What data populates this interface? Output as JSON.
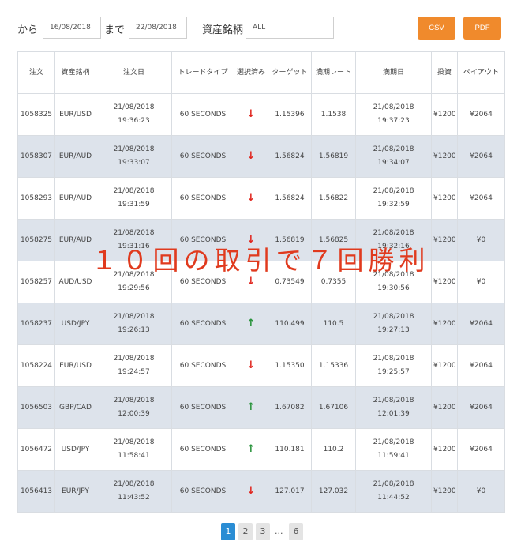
{
  "filters": {
    "from_label": "から",
    "from_value": "16/08/2018",
    "to_label": "まで",
    "to_value": "22/08/2018",
    "asset_label": "資産銘柄",
    "asset_value": "ALL",
    "csv_label": "CSV",
    "pdf_label": "PDF"
  },
  "table": {
    "headers": [
      "注文",
      "資産銘柄",
      "注文日",
      "トレードタイプ",
      "選択済み",
      "ターゲット",
      "満期レート",
      "満期日",
      "投資",
      "ペイアウト"
    ],
    "rows": [
      {
        "id": "1058325",
        "asset": "EUR/USD",
        "order_date": "21/08/2018",
        "order_time": "19:36:23",
        "type": "60 SECONDS",
        "direction": "down",
        "target": "1.15396",
        "expiry_rate": "1.1538",
        "expiry_date": "21/08/2018",
        "expiry_time": "19:37:23",
        "investment": "¥1200",
        "payout": "¥2064"
      },
      {
        "id": "1058307",
        "asset": "EUR/AUD",
        "order_date": "21/08/2018",
        "order_time": "19:33:07",
        "type": "60 SECONDS",
        "direction": "down",
        "target": "1.56824",
        "expiry_rate": "1.56819",
        "expiry_date": "21/08/2018",
        "expiry_time": "19:34:07",
        "investment": "¥1200",
        "payout": "¥2064"
      },
      {
        "id": "1058293",
        "asset": "EUR/AUD",
        "order_date": "21/08/2018",
        "order_time": "19:31:59",
        "type": "60 SECONDS",
        "direction": "down",
        "target": "1.56824",
        "expiry_rate": "1.56822",
        "expiry_date": "21/08/2018",
        "expiry_time": "19:32:59",
        "investment": "¥1200",
        "payout": "¥2064"
      },
      {
        "id": "1058275",
        "asset": "EUR/AUD",
        "order_date": "21/08/2018",
        "order_time": "19:31:16",
        "type": "60 SECONDS",
        "direction": "down",
        "target": "1.56819",
        "expiry_rate": "1.56825",
        "expiry_date": "21/08/2018",
        "expiry_time": "19:32:16",
        "investment": "¥1200",
        "payout": "¥0"
      },
      {
        "id": "1058257",
        "asset": "AUD/USD",
        "order_date": "21/08/2018",
        "order_time": "19:29:56",
        "type": "60 SECONDS",
        "direction": "down",
        "target": "0.73549",
        "expiry_rate": "0.7355",
        "expiry_date": "21/08/2018",
        "expiry_time": "19:30:56",
        "investment": "¥1200",
        "payout": "¥0"
      },
      {
        "id": "1058237",
        "asset": "USD/JPY",
        "order_date": "21/08/2018",
        "order_time": "19:26:13",
        "type": "60 SECONDS",
        "direction": "up",
        "target": "110.499",
        "expiry_rate": "110.5",
        "expiry_date": "21/08/2018",
        "expiry_time": "19:27:13",
        "investment": "¥1200",
        "payout": "¥2064"
      },
      {
        "id": "1058224",
        "asset": "EUR/USD",
        "order_date": "21/08/2018",
        "order_time": "19:24:57",
        "type": "60 SECONDS",
        "direction": "down",
        "target": "1.15350",
        "expiry_rate": "1.15336",
        "expiry_date": "21/08/2018",
        "expiry_time": "19:25:57",
        "investment": "¥1200",
        "payout": "¥2064"
      },
      {
        "id": "1056503",
        "asset": "GBP/CAD",
        "order_date": "21/08/2018",
        "order_time": "12:00:39",
        "type": "60 SECONDS",
        "direction": "up",
        "target": "1.67082",
        "expiry_rate": "1.67106",
        "expiry_date": "21/08/2018",
        "expiry_time": "12:01:39",
        "investment": "¥1200",
        "payout": "¥2064"
      },
      {
        "id": "1056472",
        "asset": "USD/JPY",
        "order_date": "21/08/2018",
        "order_time": "11:58:41",
        "type": "60 SECONDS",
        "direction": "up",
        "target": "110.181",
        "expiry_rate": "110.2",
        "expiry_date": "21/08/2018 11:59:41",
        "expiry_time": "",
        "investment": "¥1200",
        "payout": "¥2064"
      },
      {
        "id": "1056413",
        "asset": "EUR/JPY",
        "order_date": "21/08/2018",
        "order_time": "11:43:52",
        "type": "60 SECONDS",
        "direction": "down",
        "target": "127.017",
        "expiry_rate": "127.032",
        "expiry_date": "21/08/2018 11:44:52",
        "expiry_time": "",
        "investment": "¥1200",
        "payout": "¥0"
      }
    ]
  },
  "overlay_text": "１０回の取引で７回勝利",
  "pagination": {
    "pages": [
      "1",
      "2",
      "3"
    ],
    "ellipsis": "...",
    "last": "6",
    "active": "1"
  },
  "icons": {
    "up": "arrow-up-icon",
    "down": "arrow-down-icon"
  },
  "colors": {
    "accent": "#f08a2c",
    "row_alt": "#dde3eb",
    "up": "#27923a",
    "down": "#e0261f",
    "page_active": "#2a8dd4",
    "overlay": "#e03a1e"
  }
}
